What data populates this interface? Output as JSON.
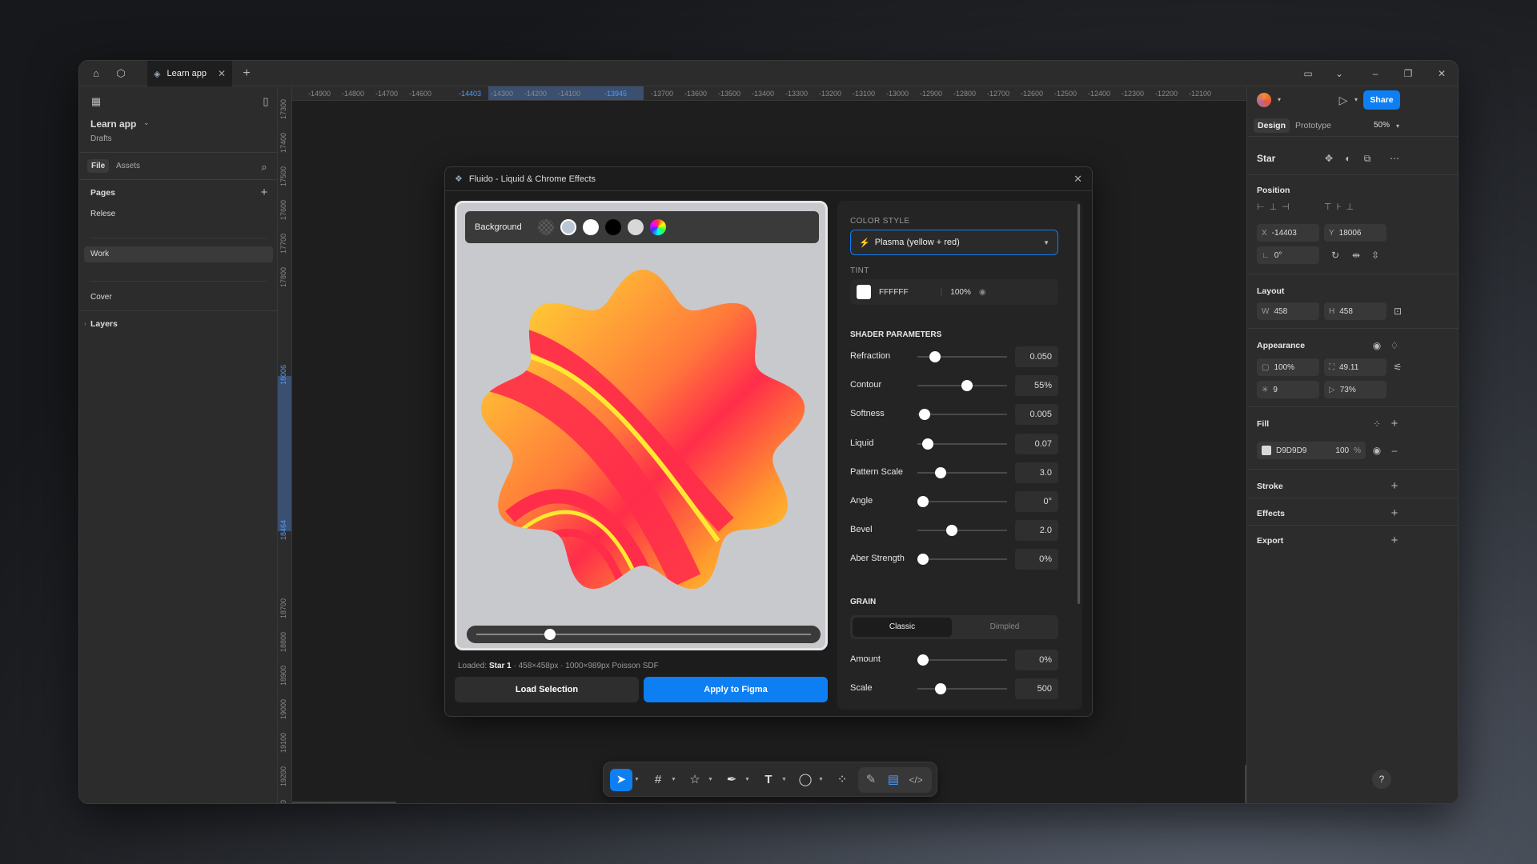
{
  "titlebar": {
    "home_icon": "home-icon",
    "community_icon": "cube-icon",
    "tab_label": "Learn app",
    "tab_close": "✕",
    "new_tab": "+"
  },
  "left_panel": {
    "file_name": "Learn app",
    "location": "Drafts",
    "tabs": [
      "File",
      "Assets"
    ],
    "pages_label": "Pages",
    "pages": [
      "Relese",
      "Work",
      "Cover"
    ],
    "layers_label": "Layers"
  },
  "ruler_h": [
    "-14900",
    "-14800",
    "-14700",
    "-14600",
    "-14403",
    "-14300",
    "-14200",
    "-14100",
    "-13945",
    "-13700",
    "-13600",
    "-13500",
    "-13400",
    "-13300",
    "-13200",
    "-13100",
    "-13000",
    "-12900",
    "-12800",
    "-12700",
    "-12600",
    "-12500",
    "-12400",
    "-12300",
    "-12200",
    "-12100"
  ],
  "ruler_v": [
    "17300",
    "17400",
    "17500",
    "17600",
    "17700",
    "17800",
    "18006",
    "18464",
    "18700",
    "18800",
    "18900",
    "19000",
    "19100",
    "19200",
    "19300"
  ],
  "plugin": {
    "title": "Fluido - Liquid & Chrome Effects",
    "background_label": "Background",
    "loaded_prefix": "Loaded:",
    "loaded_name": "Star 1",
    "loaded_info": "· 458×458px · 1000×989px Poisson SDF",
    "load_selection": "Load Selection",
    "apply": "Apply to Figma",
    "color_style_label": "COLOR STYLE",
    "color_style_value": "Plasma (yellow + red)",
    "tint_label": "TINT",
    "tint_hex": "FFFFFF",
    "tint_opacity": "100%",
    "shader_label": "SHADER PARAMETERS",
    "params": [
      {
        "label": "Refraction",
        "value": "0.050",
        "level": 0.2
      },
      {
        "label": "Contour",
        "value": "55%",
        "level": 0.55
      },
      {
        "label": "Softness",
        "value": "0.005",
        "level": 0.08
      },
      {
        "label": "Liquid",
        "value": "0.07",
        "level": 0.12
      },
      {
        "label": "Pattern Scale",
        "value": "3.0",
        "level": 0.26
      },
      {
        "label": "Angle",
        "value": "0°",
        "level": 0.06
      },
      {
        "label": "Bevel",
        "value": "2.0",
        "level": 0.38
      },
      {
        "label": "Aber Strength",
        "value": "0%",
        "level": 0.06
      }
    ],
    "grain_label": "GRAIN",
    "grain_modes": [
      "Classic",
      "Dimpled"
    ],
    "grain_params": [
      {
        "label": "Amount",
        "value": "0%",
        "level": 0.06
      },
      {
        "label": "Scale",
        "value": "500",
        "level": 0.26
      }
    ],
    "preview_slider_level": 0.22,
    "bg_colors": [
      "#b9c6d6",
      "#ffffff",
      "#000000",
      "#d8d8d8"
    ]
  },
  "right_panel": {
    "share": "Share",
    "tabs": [
      "Design",
      "Prototype"
    ],
    "zoom": "50%",
    "layer_name": "Star",
    "position_label": "Position",
    "x_key": "X",
    "x_val": "-14403",
    "y_key": "Y",
    "y_val": "18006",
    "rotation": "0°",
    "layout_label": "Layout",
    "w_key": "W",
    "w_val": "458",
    "h_key": "H",
    "h_val": "458",
    "appearance_label": "Appearance",
    "opacity": "100%",
    "corner": "49.11",
    "points": "9",
    "ratio": "73%",
    "fill_label": "Fill",
    "fill_hex": "D9D9D9",
    "fill_opacity": "100",
    "fill_pct": "%",
    "stroke_label": "Stroke",
    "effects_label": "Effects",
    "export_label": "Export",
    "help": "?"
  },
  "colors": {
    "accent": "#0d7ff2",
    "preview_bg": "#c7c9cd",
    "star_yellow": "#ffe832",
    "star_red": "#ff2d4a"
  }
}
